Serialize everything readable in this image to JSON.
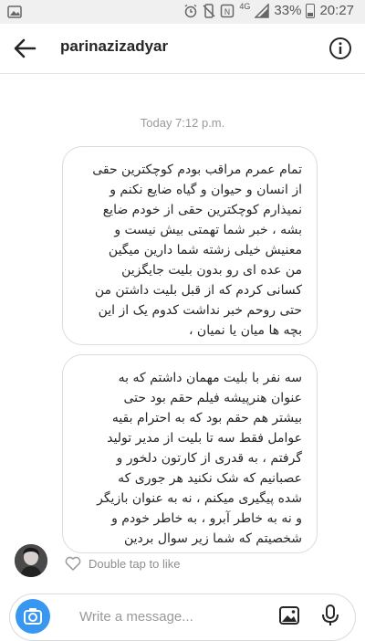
{
  "status_bar": {
    "network": "4G",
    "battery": "33%",
    "time": "20:27",
    "icons": [
      "image-icon",
      "alarm-icon",
      "silent-icon",
      "nfc-icon",
      "signal-icon",
      "battery-icon"
    ]
  },
  "header": {
    "username": "parinazizadyar",
    "icons": [
      "back-arrow-icon",
      "info-icon"
    ]
  },
  "conversation": {
    "timestamp": "Today 7:12 p.m.",
    "messages": [
      {
        "lines": [
          "تمام عمرم مراقب بودم کوچکترین حقی",
          "از انسان و حیوان و گیاه ضایع نکنم و",
          "نمیذارم کوچکترین حقی از خودم ضایع",
          "بشه ، خبر شما تهمتی بیش نیست و",
          "معنیش خیلی زشته شما دارین میگین",
          "من عده ای رو بدون بلیت جایگزین",
          "کسانی کردم که از قبل بلیت داشتن من",
          "حتی روحم خبر نداشت کدوم یک از این",
          "بچه ها میان یا نمیان ،"
        ]
      },
      {
        "lines": [
          "سه نفر با بلیت مهمان داشتم که به",
          "عنوان هنرپیشه فیلم حقم بود حتی",
          "بیشتر هم حقم بود که به احترام بقیه",
          "عوامل فقط سه تا بلیت از مدیر تولید",
          "گرفتم ، به قدری از کارتون دلخور و",
          "عصبانیم که شک نکنید هر جوری که",
          "شده پیگیری میکنم ، نه به عنوان بازیگر",
          "و نه به خاطر آبرو ، به خاطر خودم و",
          "شخصیتم که شما زیر سوال بردین"
        ]
      }
    ],
    "like_hint": "Double tap to like"
  },
  "composer": {
    "placeholder": "Write a message...",
    "icons": [
      "camera-icon",
      "gallery-icon",
      "microphone-icon"
    ],
    "accent": "#3897f0"
  }
}
